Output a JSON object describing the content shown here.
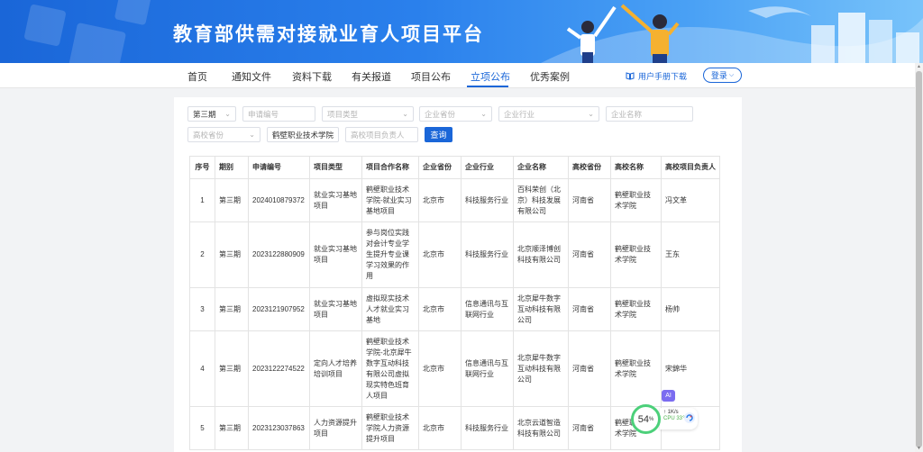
{
  "header": {
    "title": "教育部供需对接就业育人项目平台"
  },
  "nav": {
    "items": [
      {
        "label": "首页",
        "active": false
      },
      {
        "label": "通知文件",
        "active": false
      },
      {
        "label": "资料下载",
        "active": false
      },
      {
        "label": "有关报道",
        "active": false
      },
      {
        "label": "项目公布",
        "active": false
      },
      {
        "label": "立项公布",
        "active": true
      },
      {
        "label": "优秀案例",
        "active": false
      }
    ],
    "manual_label": "用户手册下载",
    "login_label": "登录"
  },
  "filters": {
    "batch": "第三期",
    "app_no_placeholder": "申请编号",
    "project_type_placeholder": "项目类型",
    "company_province_placeholder": "企业省份",
    "company_industry_placeholder": "企业行业",
    "company_name_placeholder": "企业名称",
    "school_province_placeholder": "高校省份",
    "school_name": "鹤壁职业技术学院",
    "school_leader_placeholder": "高校项目负责人",
    "search_label": "查询"
  },
  "table": {
    "headers": [
      "序号",
      "期别",
      "申请编号",
      "项目类型",
      "项目合作名称",
      "企业省份",
      "企业行业",
      "企业名称",
      "高校省份",
      "高校名称",
      "高校项目负责人"
    ],
    "rows": [
      [
        "1",
        "第三期",
        "2024010879372",
        "就业实习基地项目",
        "鹤壁职业技术学院-就业实习基地项目",
        "北京市",
        "科技服务行业",
        "百科荣创（北京）科技发展有限公司",
        "河南省",
        "鹤壁职业技术学院",
        "冯文革"
      ],
      [
        "2",
        "第三期",
        "2023122880909",
        "就业实习基地项目",
        "参与岗位实践对会计专业学生提升专业课学习效果的作用",
        "北京市",
        "科技服务行业",
        "北京顺泽博创科技有限公司",
        "河南省",
        "鹤壁职业技术学院",
        "王东"
      ],
      [
        "3",
        "第三期",
        "2023121907952",
        "就业实习基地项目",
        "虚拟现实技术人才就业实习基地",
        "北京市",
        "信息通讯与互联网行业",
        "北京犀牛数字互动科技有限公司",
        "河南省",
        "鹤壁职业技术学院",
        "杨帅"
      ],
      [
        "4",
        "第三期",
        "2023122274522",
        "定向人才培养培训项目",
        "鹤壁职业技术学院-北京犀牛数字互动科技有限公司虚拟现实特色班育人项目",
        "北京市",
        "信息通讯与互联网行业",
        "北京犀牛数字互动科技有限公司",
        "河南省",
        "鹤壁职业技术学院",
        "宋錦华"
      ],
      [
        "5",
        "第三期",
        "2023123037863",
        "人力资源提升项目",
        "鹤壁职业技术学院人力资源提升项目",
        "北京市",
        "科技服务行业",
        "北京云道智造科技有限公司",
        "河南省",
        "鹤壁职业技术学院",
        ""
      ]
    ]
  },
  "widget": {
    "ai_label": "AI",
    "percent": "54",
    "percent_unit": "%",
    "net": "1K/s",
    "cpu": "CPU 33℃"
  },
  "colors": {
    "primary": "#1a66d8",
    "gauge": "#4cd07a"
  }
}
